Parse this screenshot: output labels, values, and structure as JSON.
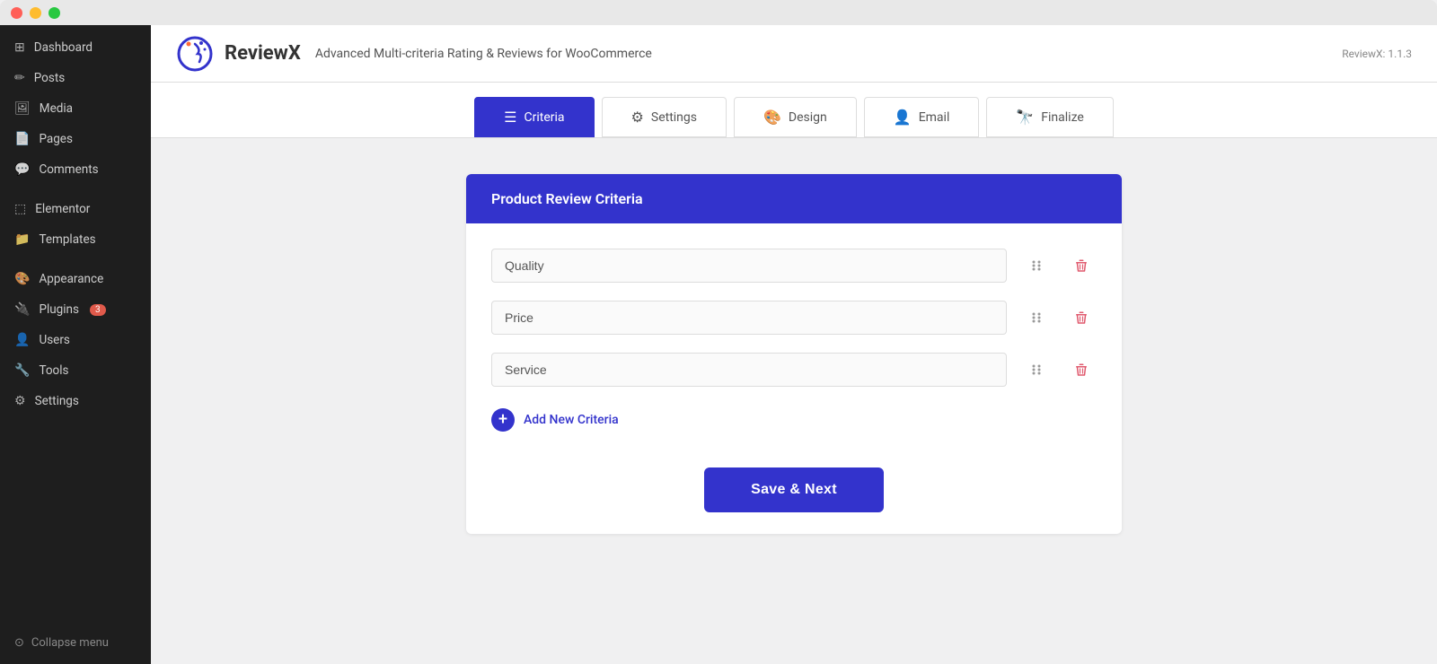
{
  "window": {
    "buttons": {
      "close": "close",
      "minimize": "minimize",
      "maximize": "maximize"
    }
  },
  "header": {
    "brand_name": "ReviewX",
    "tagline": "Advanced Multi-criteria Rating & Reviews for WooCommerce",
    "version": "ReviewX: 1.1.3"
  },
  "nav_tabs": [
    {
      "id": "criteria",
      "label": "Criteria",
      "icon": "☰",
      "active": true
    },
    {
      "id": "settings",
      "label": "Settings",
      "icon": "⚙"
    },
    {
      "id": "design",
      "label": "Design",
      "icon": "🎨"
    },
    {
      "id": "email",
      "label": "Email",
      "icon": "👤"
    },
    {
      "id": "finalize",
      "label": "Finalize",
      "icon": "🔭"
    }
  ],
  "sidebar": {
    "items": [
      {
        "id": "dashboard",
        "label": "Dashboard",
        "icon": "⊞"
      },
      {
        "id": "posts",
        "label": "Posts",
        "icon": "✏"
      },
      {
        "id": "media",
        "label": "Media",
        "icon": "🖼"
      },
      {
        "id": "pages",
        "label": "Pages",
        "icon": "📄"
      },
      {
        "id": "comments",
        "label": "Comments",
        "icon": "💬"
      },
      {
        "id": "elementor",
        "label": "Elementor",
        "icon": "⬚"
      },
      {
        "id": "templates",
        "label": "Templates",
        "icon": "📁"
      },
      {
        "id": "appearance",
        "label": "Appearance",
        "icon": "🎨"
      },
      {
        "id": "plugins",
        "label": "Plugins",
        "icon": "🔌",
        "badge": "3"
      },
      {
        "id": "users",
        "label": "Users",
        "icon": "👤"
      },
      {
        "id": "tools",
        "label": "Tools",
        "icon": "🔧"
      },
      {
        "id": "settings",
        "label": "Settings",
        "icon": "⚙"
      }
    ],
    "collapse_label": "Collapse menu"
  },
  "criteria_card": {
    "title": "Product Review Criteria",
    "criteria": [
      {
        "id": "quality",
        "value": "Quality",
        "placeholder": "Quality"
      },
      {
        "id": "price",
        "value": "Price",
        "placeholder": "Price"
      },
      {
        "id": "service",
        "value": "Service",
        "placeholder": "Service"
      }
    ],
    "add_label": "Add New Criteria",
    "save_label": "Save & Next"
  },
  "colors": {
    "accent": "#3333cc",
    "delete": "#e05a6e",
    "sidebar_bg": "#1e1e1e",
    "badge_bg": "#e05a4b"
  }
}
